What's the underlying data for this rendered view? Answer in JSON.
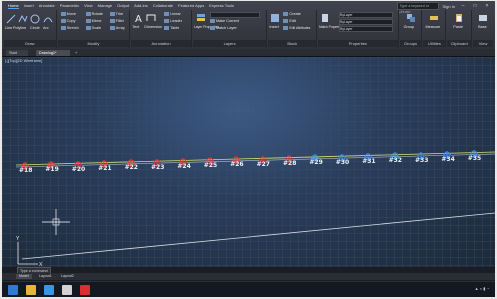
{
  "ribbon": {
    "menus": [
      "Home",
      "Insert",
      "Annotate",
      "Parametric",
      "View",
      "Manage",
      "Output",
      "Add-ins",
      "Collaborate",
      "Featured Apps",
      "Express Tools"
    ],
    "search_placeholder": "Type a keyword or phrase",
    "signin": "Sign In",
    "panels": {
      "draw": {
        "title": "Draw",
        "tools": [
          "Line",
          "Polyline",
          "Circle",
          "Arc"
        ]
      },
      "modify": {
        "title": "Modify",
        "tools": [
          "Move",
          "Rotate",
          "Trim",
          "Copy",
          "Mirror",
          "Fillet",
          "Stretch",
          "Scale",
          "Array"
        ]
      },
      "annotation": {
        "title": "Annotation",
        "tools": [
          "Text",
          "Dimension",
          "Linear",
          "Leader",
          "Table"
        ]
      },
      "layers": {
        "title": "Layers",
        "tools": [
          "Layer Properties",
          "Make Current",
          "Match Layer"
        ]
      },
      "block": {
        "title": "Block",
        "tools": [
          "Insert",
          "Create",
          "Edit",
          "Edit Attributes"
        ]
      },
      "properties": {
        "title": "Properties",
        "tools": [
          "Match Properties",
          "ByLayer",
          "ByLayer",
          "ByLayer"
        ]
      },
      "groups": {
        "title": "Groups",
        "tools": [
          "Group"
        ]
      },
      "utilities": {
        "title": "Utilities",
        "tools": [
          "Measure"
        ]
      },
      "clipboard": {
        "title": "Clipboard",
        "tools": [
          "Paste"
        ]
      },
      "view": {
        "title": "View",
        "tools": [
          "Base"
        ]
      }
    }
  },
  "file_tabs": {
    "start": "Start",
    "drawing": "Drawing1*",
    "plus": "+"
  },
  "viewport_controls": "[-][Top][2D Wireframe]",
  "markers": [
    {
      "label": "#18",
      "color": "#e23838"
    },
    {
      "label": "#19",
      "color": "#e23838"
    },
    {
      "label": "#20",
      "color": "#e23838"
    },
    {
      "label": "#21",
      "color": "#e23838"
    },
    {
      "label": "#22",
      "color": "#e23838"
    },
    {
      "label": "#23",
      "color": "#e23838"
    },
    {
      "label": "#24",
      "color": "#e23838"
    },
    {
      "label": "#25",
      "color": "#e23838"
    },
    {
      "label": "#26",
      "color": "#e23838"
    },
    {
      "label": "#27",
      "color": "#e23838"
    },
    {
      "label": "#28",
      "color": "#e23838"
    },
    {
      "label": "#29",
      "color": "#3a8ee8"
    },
    {
      "label": "#30",
      "color": "#3a8ee8"
    },
    {
      "label": "#31",
      "color": "#3a8ee8"
    },
    {
      "label": "#32",
      "color": "#3a8ee8"
    },
    {
      "label": "#33",
      "color": "#3a8ee8"
    },
    {
      "label": "#34",
      "color": "#3a8ee8"
    },
    {
      "label": "#35",
      "color": "#3a8ee8"
    }
  ],
  "command_line_placeholder": "Type a command",
  "layout_tabs": [
    "Model",
    "Layout1",
    "Layout2"
  ],
  "ucs_labels": {
    "y": "Y",
    "x": "X"
  },
  "colors": {
    "accent": "#5fa0e8",
    "marker_red": "#e23838",
    "marker_blue": "#3a8ee8"
  }
}
